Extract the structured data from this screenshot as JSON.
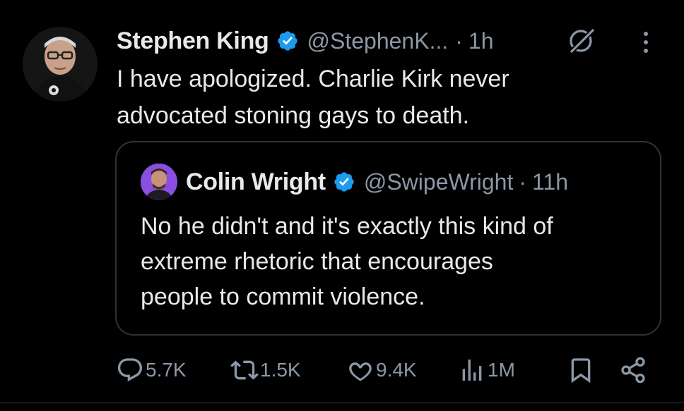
{
  "tweet": {
    "author": {
      "name": "Stephen King",
      "handle": "@StephenK...",
      "separator": "·",
      "time": "1h"
    },
    "text_line1": "I have apologized. Charlie Kirk never",
    "text_line2": "advocated stoning gays to death.",
    "quote": {
      "author": {
        "name": "Colin Wright",
        "handle": "@SwipeWright",
        "separator": "·",
        "time": "11h"
      },
      "text_line1": "No he didn't and it's exactly this kind of",
      "text_line2": "extreme rhetoric that encourages",
      "text_line3": "people to commit violence."
    },
    "actions": {
      "replies": "5.7K",
      "reposts": "1.5K",
      "likes": "9.4K",
      "views": "1M"
    }
  },
  "icons": {
    "verified": "verified-badge-icon",
    "grok": "grok-icon",
    "more": "more-vertical-icon",
    "reply": "reply-icon",
    "repost": "repost-icon",
    "like": "heart-icon",
    "views": "views-chart-icon",
    "bookmark": "bookmark-icon",
    "share": "share-icon"
  },
  "colors": {
    "background": "#000000",
    "text": "#e7e9ea",
    "secondary": "#8b98a5",
    "verified": "#1d9bf0",
    "border": "#2f3336"
  }
}
